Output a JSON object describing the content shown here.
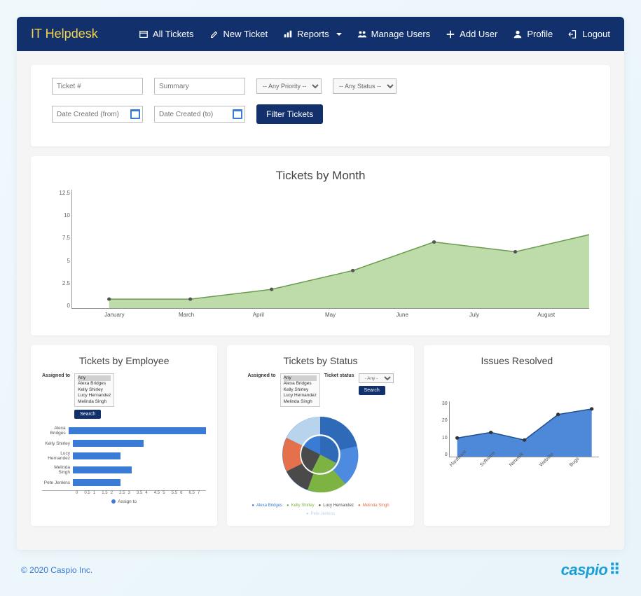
{
  "brand": "IT Helpdesk",
  "nav": {
    "all_tickets": "All Tickets",
    "new_ticket": "New Ticket",
    "reports": "Reports",
    "manage_users": "Manage Users",
    "add_user": "Add User",
    "profile": "Profile",
    "logout": "Logout"
  },
  "filters": {
    "ticket_placeholder": "Ticket #",
    "summary_placeholder": "Summary",
    "priority_placeholder": "-- Any Priority --",
    "status_placeholder": "-- Any Status --",
    "date_from_placeholder": "Date Created (from)",
    "date_to_placeholder": "Date Created (to)",
    "filter_btn": "Filter Tickets"
  },
  "tickets_by_month": {
    "title": "Tickets by Month",
    "y_ticks": [
      "12.5",
      "10",
      "7.5",
      "5",
      "2.5",
      "0"
    ],
    "x_labels": [
      "January",
      "March",
      "April",
      "May",
      "June",
      "July",
      "August"
    ]
  },
  "tickets_by_employee": {
    "title": "Tickets by Employee",
    "filter_label": "Assigned to",
    "options": [
      "Any",
      "Alexa Bridges",
      "Kelly Shirley",
      "Lucy Hernandez",
      "Melinda Singh"
    ],
    "search": "Search",
    "rows_label": {
      "0": "Alexa Bridges",
      "1": "Kelly Shirley",
      "2": "Lucy Hernandez",
      "3": "Melinda Singh",
      "4": "Pete Jenkins"
    },
    "axis": {
      "0": "0",
      "1": "0.5",
      "2": "1",
      "3": "1.5",
      "4": "2",
      "5": "2.5",
      "6": "3",
      "7": "3.5",
      "8": "4",
      "9": "4.5",
      "10": "5",
      "11": "5.5",
      "12": "6",
      "13": "6.5",
      "14": "7"
    },
    "legend": "Assign to"
  },
  "tickets_by_status": {
    "title": "Tickets by Status",
    "assigned_label": "Assigned to",
    "ticket_status_label": "Ticket status",
    "status_sel": "- Any -",
    "options": [
      "Any",
      "Alexa Bridges",
      "Kelly Shirley",
      "Lucy Hernandez",
      "Melinda Singh"
    ],
    "search": "Search",
    "legend": {
      "0": "Alexa Bridges",
      "1": "Kelly Shirley",
      "2": "Lucy Hernandez",
      "3": "Melinda Singh",
      "4": "Pete Jenkins"
    }
  },
  "issues_resolved": {
    "title": "Issues Resolved",
    "y_ticks": {
      "0": "30",
      "1": "20",
      "2": "10",
      "3": "0"
    },
    "x_labels": {
      "0": "Hardware",
      "1": "Software",
      "2": "Network",
      "3": "Website",
      "4": "Bugs"
    }
  },
  "footer": {
    "copyright": "© 2020 Caspio Inc.",
    "logo": "caspio"
  },
  "chart_data": [
    {
      "type": "area",
      "title": "Tickets by Month",
      "categories": [
        "January",
        "March",
        "April",
        "May",
        "June",
        "July",
        "August"
      ],
      "values": [
        1,
        1,
        2,
        4,
        7,
        6,
        8
      ],
      "ylim": [
        0,
        12.5
      ],
      "xlabel": "",
      "ylabel": ""
    },
    {
      "type": "bar",
      "title": "Tickets by Employee",
      "orientation": "horizontal",
      "categories": [
        "Alexa Bridges",
        "Kelly Shirley",
        "Lucy Hernandez",
        "Melinda Singh",
        "Pete Jenkins"
      ],
      "values": [
        7,
        3,
        2,
        2.5,
        2
      ],
      "xlim": [
        0,
        7
      ],
      "legend": [
        "Assign to"
      ],
      "xlabel": "",
      "ylabel": ""
    },
    {
      "type": "pie",
      "title": "Tickets by Status",
      "series": [
        "Alexa Bridges",
        "Kelly Shirley",
        "Lucy Hernandez",
        "Melinda Singh",
        "Pete Jenkins"
      ],
      "note": "nested donut; outer slice proportions approximate"
    },
    {
      "type": "area",
      "title": "Issues Resolved",
      "categories": [
        "Hardware",
        "Software",
        "Network",
        "Website",
        "Bugs"
      ],
      "values": [
        10,
        13,
        9,
        23,
        26
      ],
      "ylim": [
        0,
        30
      ],
      "xlabel": "",
      "ylabel": ""
    }
  ]
}
